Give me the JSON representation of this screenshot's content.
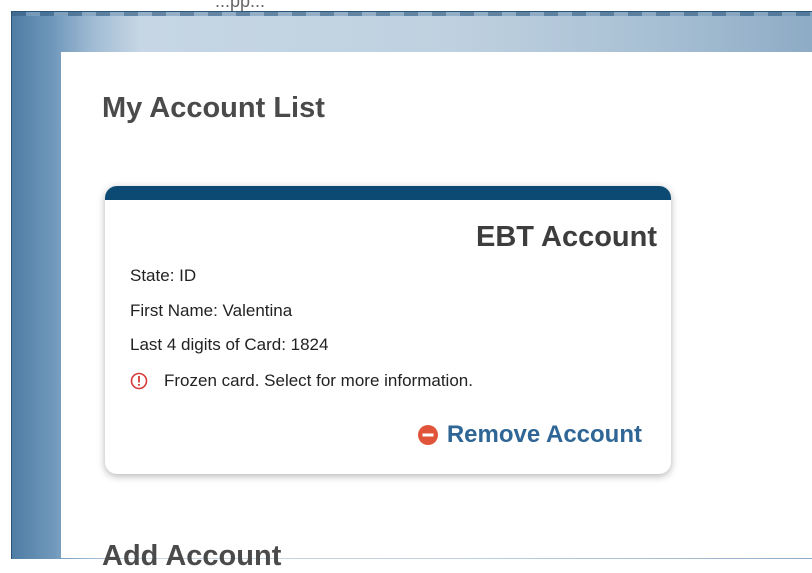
{
  "header": {
    "partial_text": "...pp..."
  },
  "page": {
    "title": "My Account List",
    "add_account_heading": "Add Account"
  },
  "account_card": {
    "title": "EBT Account",
    "state": "State: ID",
    "first_name": "First Name: Valentina",
    "last_digits": "Last 4 digits of Card: 1824",
    "alert_text": "Frozen card. Select for more information.",
    "alert_icon": "alert-circle-icon",
    "remove_label": "Remove Account",
    "remove_icon": "minus-circle-icon"
  },
  "colors": {
    "card_bar": "#0c4a73",
    "link": "#2f6696",
    "alert": "#d63a3a",
    "remove_icon": "#e0553a"
  }
}
